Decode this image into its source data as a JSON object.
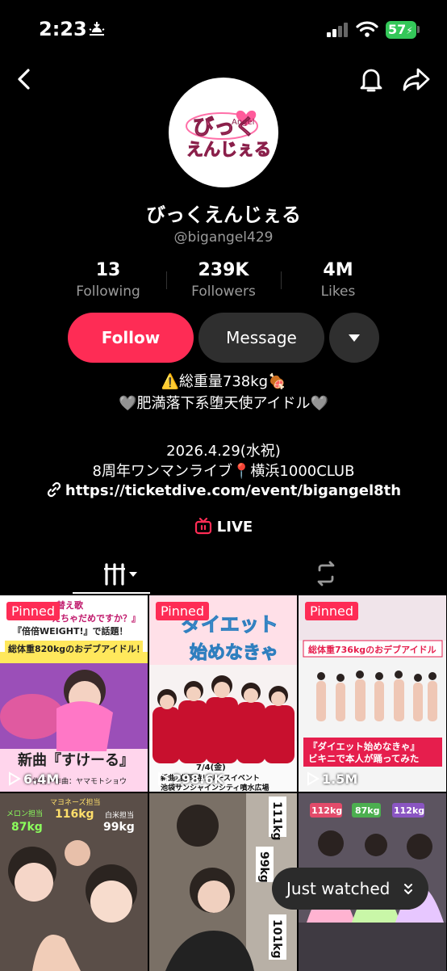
{
  "status_bar": {
    "time": "2:23",
    "battery": "57"
  },
  "profile": {
    "avatar_text_top": "びっく",
    "avatar_text_bottom": "えんじぇる",
    "avatar_small": "Angel",
    "display_name": "びっくえんじぇる",
    "username": "@bigangel429"
  },
  "stats": [
    {
      "value": "13",
      "label": "Following"
    },
    {
      "value": "239K",
      "label": "Followers"
    },
    {
      "value": "4M",
      "label": "Likes"
    }
  ],
  "actions": {
    "follow": "Follow",
    "message": "Message"
  },
  "bio": {
    "line1": "⚠️総重量738kg🍖",
    "line2": "🩶肥満落下系堕天使アイドル🩶",
    "line3": "2026.4.29(水祝)",
    "line4": "8周年ワンマンライブ📍横浜1000CLUB",
    "link": "https://ticketdive.com/event/bigangel8th"
  },
  "live_label": "LIVE",
  "grid": [
    {
      "pinned": "Pinned",
      "views": "6.4M",
      "lines": [
        "替え歌",
        "えちゃだめですか？』",
        "『倍倍WEIGHT!』で話題！",
        "総体重820kgのおデブアイドル！",
        "新曲『すけーる』",
        "作詞・作曲：ヤマモトショウ"
      ]
    },
    {
      "pinned": "Pinned",
      "views": "298.6K",
      "lines": [
        "ダイエット",
        "始めなきゃ",
        "7/4(金)",
        "新曲2曲同時リリースイベント",
        "池袋サンシャインシティ噴水広場"
      ]
    },
    {
      "pinned": "Pinned",
      "views": "1.5M",
      "lines": [
        "総体重736kgのおデブアイドル",
        "『ダイエット始めなきゃ』",
        "ビキニで本人が踊ってみた"
      ]
    },
    {
      "lines": [
        "マヨネーズ担当",
        "116kg",
        "メロン担当",
        "87kg",
        "白米担当",
        "99kg"
      ]
    },
    {
      "lines": [
        "111kg",
        "99kg",
        "101kg"
      ]
    },
    {
      "lines": [
        "112kg",
        "87kg",
        "112kg"
      ]
    }
  ],
  "just_watched": "Just watched",
  "colors": {
    "accent": "#fe2c55",
    "battery": "#34c759",
    "surface": "#2f2f2f"
  }
}
